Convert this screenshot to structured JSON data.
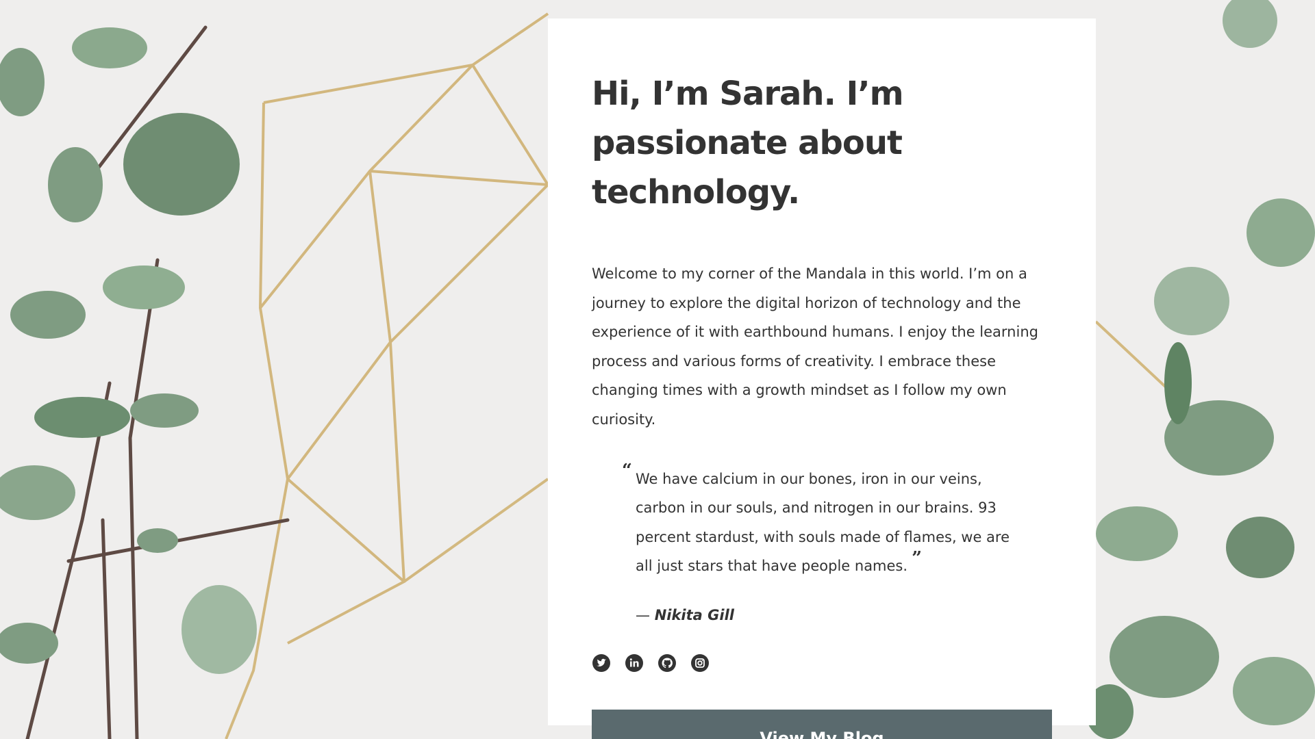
{
  "hero": {
    "headline": "Hi, I’m Sarah. I’m passionate about technology.",
    "intro": "Welcome to my corner of the Mandala in this world. I’m on a journey to explore the digital horizon of technology and the experience of it with earthbound humans. I enjoy the learning process and various forms of creativity. I embrace these changing times with a growth mindset as I follow my own curiosity."
  },
  "quote": {
    "open_mark": "“",
    "text": "We have calcium in our bones, iron in our veins, carbon in our souls, and nitrogen in our brains. 93 percent stardust, with souls made of flames, we are all just stars that have people names.",
    "close_mark": "”",
    "dash": "— ",
    "author": "Nikita Gill"
  },
  "socials": [
    {
      "icon": "twitter-icon"
    },
    {
      "icon": "linkedin-icon"
    },
    {
      "icon": "github-icon"
    },
    {
      "icon": "instagram-icon"
    }
  ],
  "cta": {
    "label": "View My Blog",
    "color": "#5a6a6e"
  },
  "colors": {
    "text": "#333333",
    "card": "#ffffff",
    "background": "#efeeed",
    "leaf": "#7f9c82",
    "brass": "#c9a862"
  }
}
